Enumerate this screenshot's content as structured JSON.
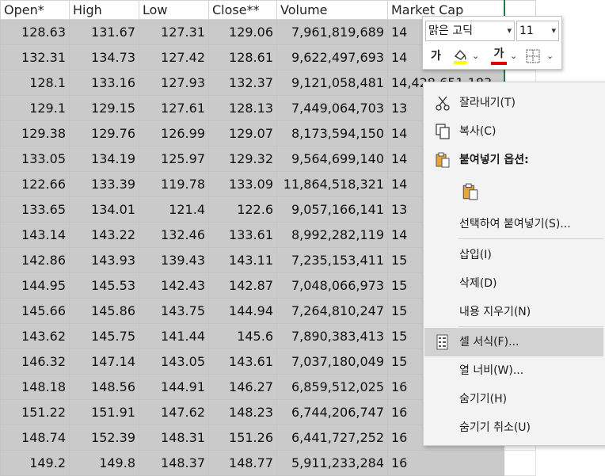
{
  "sheet": {
    "headers": [
      "Open*",
      "High",
      "Low",
      "Close**",
      "Volume",
      "Market Cap"
    ],
    "rows": [
      [
        "128.63",
        "131.67",
        "127.31",
        "129.06",
        "7,961,819,689",
        "14"
      ],
      [
        "132.31",
        "134.73",
        "127.42",
        "128.61",
        "9,622,497,693",
        "14"
      ],
      [
        "128.1",
        "133.16",
        "127.93",
        "132.37",
        "9,121,058,481",
        "14,428,651,183"
      ],
      [
        "129.1",
        "129.15",
        "127.61",
        "128.13",
        "7,449,064,703",
        "13"
      ],
      [
        "129.38",
        "129.76",
        "126.99",
        "129.07",
        "8,173,594,150",
        "14"
      ],
      [
        "133.05",
        "134.19",
        "125.97",
        "129.32",
        "9,564,699,140",
        "14"
      ],
      [
        "122.66",
        "133.39",
        "119.78",
        "133.09",
        "11,864,518,321",
        "14"
      ],
      [
        "133.65",
        "134.01",
        "121.4",
        "122.6",
        "9,057,166,141",
        "13"
      ],
      [
        "143.14",
        "143.22",
        "132.46",
        "133.61",
        "8,992,282,119",
        "14"
      ],
      [
        "142.86",
        "143.93",
        "139.43",
        "143.11",
        "7,235,153,411",
        "15"
      ],
      [
        "144.95",
        "145.53",
        "142.43",
        "142.87",
        "7,048,066,973",
        "15"
      ],
      [
        "145.66",
        "145.86",
        "143.75",
        "144.94",
        "7,264,810,247",
        "15"
      ],
      [
        "143.62",
        "145.75",
        "141.44",
        "145.6",
        "7,890,383,413",
        "15"
      ],
      [
        "146.32",
        "147.14",
        "143.05",
        "143.61",
        "7,037,180,049",
        "15"
      ],
      [
        "148.18",
        "148.56",
        "144.91",
        "146.27",
        "6,859,512,025",
        "16"
      ],
      [
        "151.22",
        "151.91",
        "147.62",
        "148.23",
        "6,744,206,747",
        "16"
      ],
      [
        "148.74",
        "152.39",
        "148.31",
        "151.26",
        "6,441,727,252",
        "16"
      ],
      [
        "149.2",
        "149.8",
        "148.37",
        "148.77",
        "5,911,233,284",
        "16"
      ]
    ]
  },
  "mini_toolbar": {
    "font_name": "맑은 고딕",
    "font_size": "11",
    "bold_glyph": "가",
    "font_color_glyph": "가",
    "fill_color": "#ffff00",
    "font_color": "#e00000"
  },
  "context_menu": {
    "items": [
      {
        "label": "잘라내기(T)",
        "icon": "scissors-icon"
      },
      {
        "label": "복사(C)",
        "icon": "copy-icon"
      },
      {
        "label": "붙여넣기 옵션:",
        "icon": "paste-icon"
      },
      {
        "label": "선택하여 붙여넣기(S)...",
        "icon": ""
      },
      {
        "label": "삽입(I)",
        "icon": ""
      },
      {
        "label": "삭제(D)",
        "icon": ""
      },
      {
        "label": "내용 지우기(N)",
        "icon": ""
      },
      {
        "label": "셀 서식(F)...",
        "icon": "format-cells-icon"
      },
      {
        "label": "열 너비(W)...",
        "icon": ""
      },
      {
        "label": "숨기기(H)",
        "icon": ""
      },
      {
        "label": "숨기기 취소(U)",
        "icon": ""
      }
    ],
    "highlighted_index": 7
  },
  "colors": {
    "selection_fill": "#cacaca",
    "selection_border": "#1f7a43"
  }
}
